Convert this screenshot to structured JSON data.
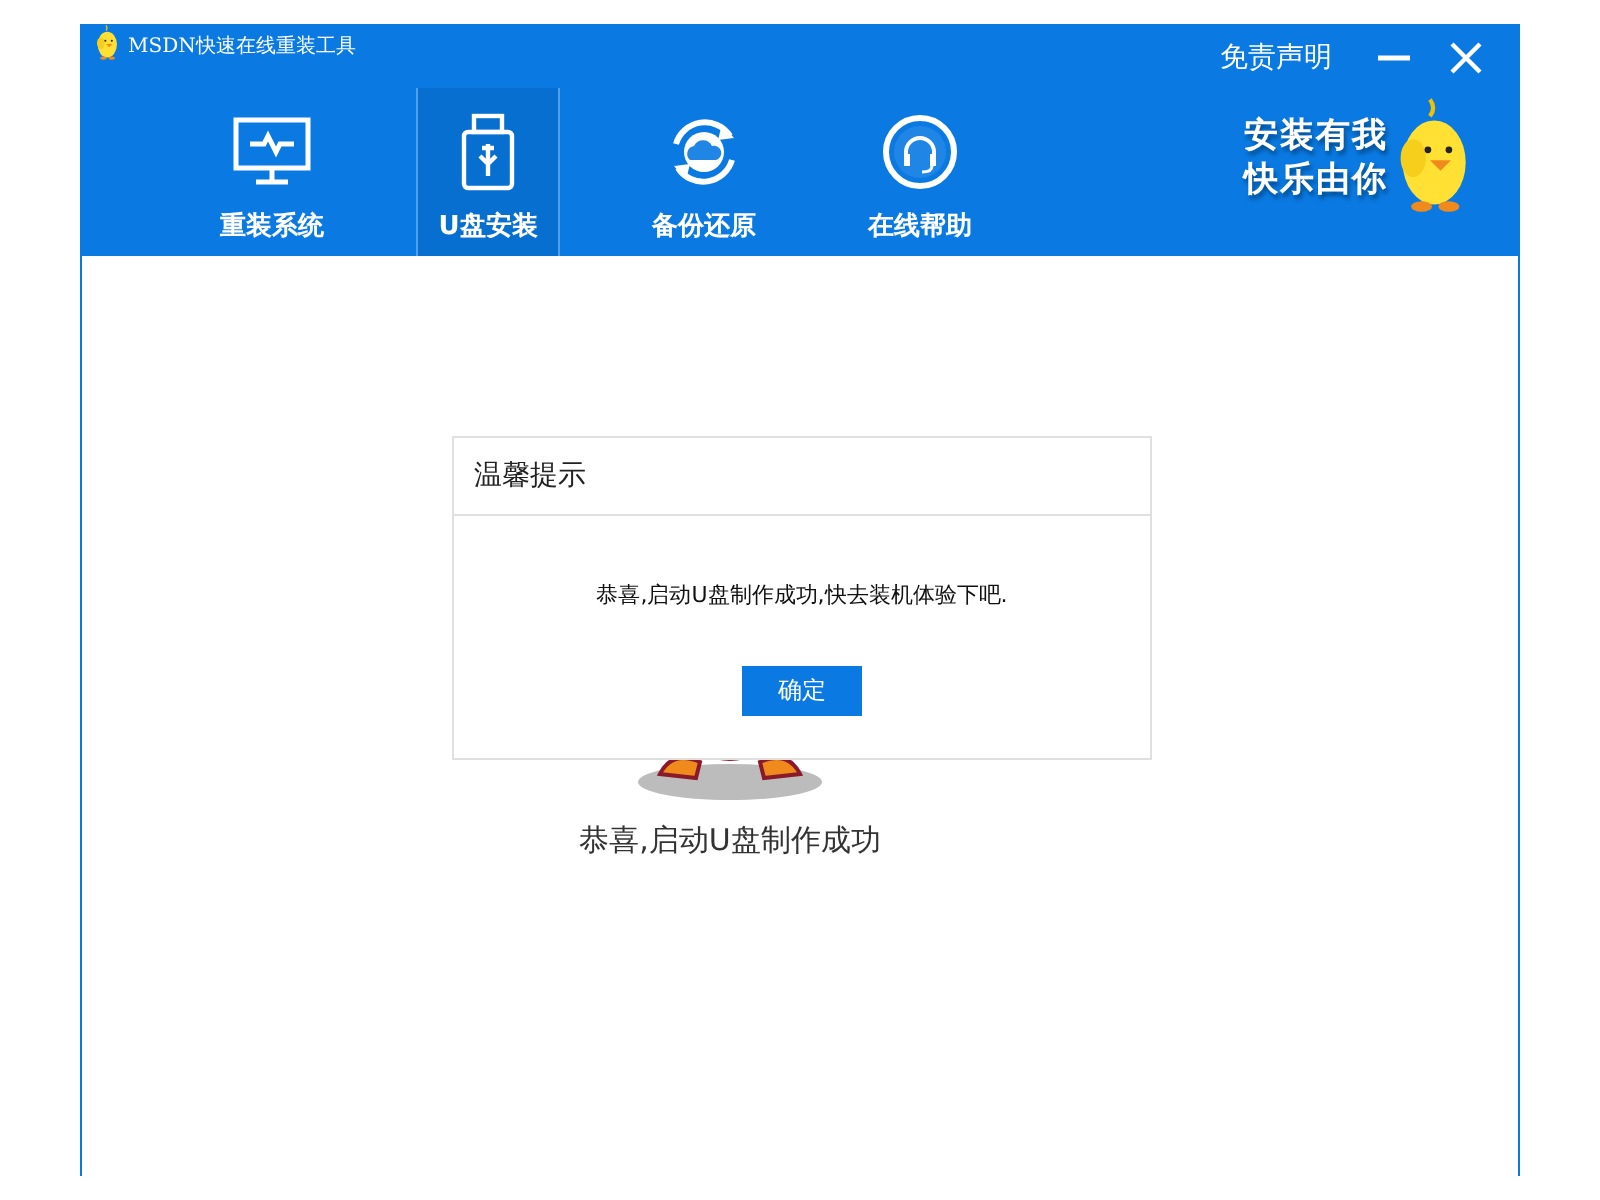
{
  "window": {
    "title": "MSDN快速在线重装工具",
    "disclaimer": "免责声明"
  },
  "nav": [
    {
      "label": "重装系统",
      "kind": "monitor",
      "selected": false
    },
    {
      "label": "U盘安装",
      "kind": "usb",
      "selected": true
    },
    {
      "label": "备份还原",
      "kind": "sync",
      "selected": false
    },
    {
      "label": "在线帮助",
      "kind": "headset",
      "selected": false
    }
  ],
  "slogan": [
    "安装有我",
    "快乐由你"
  ],
  "status_text": "恭喜,启动U盘制作成功",
  "dialog": {
    "title": "温馨提示",
    "message": "恭喜,启动U盘制作成功,快去装机体验下吧.",
    "button": "确定"
  }
}
